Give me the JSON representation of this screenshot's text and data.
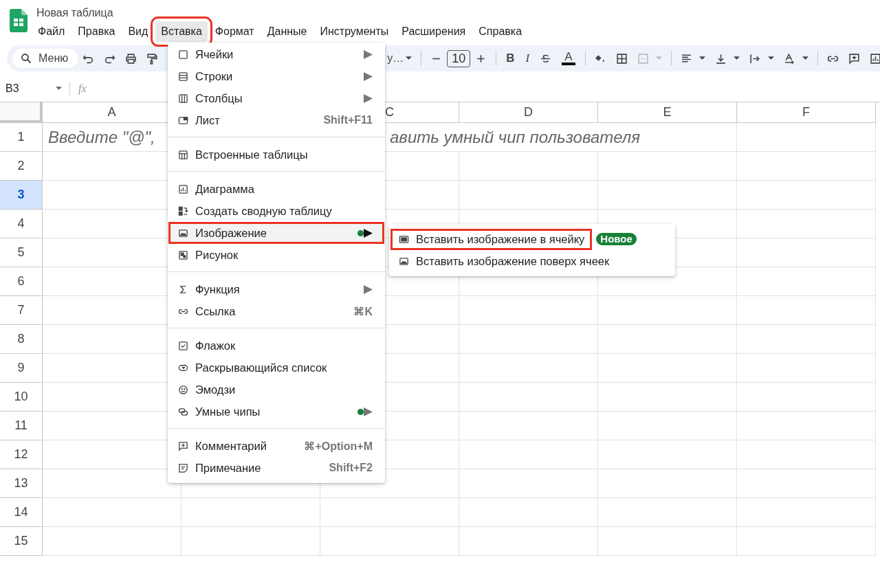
{
  "title": "Новая таблица",
  "menubar": [
    {
      "label": "Файл",
      "selected": false,
      "annotated": false
    },
    {
      "label": "Правка",
      "selected": false,
      "annotated": false
    },
    {
      "label": "Вид",
      "selected": false,
      "annotated": false
    },
    {
      "label": "Вставка",
      "selected": true,
      "annotated": true
    },
    {
      "label": "Формат",
      "selected": false,
      "annotated": false
    },
    {
      "label": "Данные",
      "selected": false,
      "annotated": false
    },
    {
      "label": "Инструменты",
      "selected": false,
      "annotated": false
    },
    {
      "label": "Расширения",
      "selected": false,
      "annotated": false
    },
    {
      "label": "Справка",
      "selected": false,
      "annotated": false
    }
  ],
  "toolbar": {
    "search": "Меню",
    "font": "у…",
    "font_size": "10",
    "bold": "B",
    "italic": "I",
    "text_color": "A"
  },
  "formula_bar": {
    "cell_ref": "B3",
    "fx": "fx"
  },
  "columns": [
    {
      "header": "A"
    },
    {},
    {
      "header": "C"
    },
    {
      "header": "D"
    },
    {
      "header": "E"
    },
    {
      "header": "F"
    }
  ],
  "rows": [
    {
      "number": "1",
      "selected": false
    },
    {
      "number": "2",
      "selected": false
    },
    {
      "number": "3",
      "selected": true
    },
    {
      "number": "4",
      "selected": false
    },
    {
      "number": "5",
      "selected": false
    },
    {
      "number": "6",
      "selected": false
    },
    {
      "number": "7",
      "selected": false
    },
    {
      "number": "8",
      "selected": false
    },
    {
      "number": "9",
      "selected": false
    },
    {
      "number": "10",
      "selected": false
    },
    {
      "number": "11",
      "selected": false
    },
    {
      "number": "12",
      "selected": false
    },
    {
      "number": "13",
      "selected": false
    },
    {
      "number": "14",
      "selected": false
    },
    {
      "number": "15",
      "selected": false
    }
  ],
  "row_1_hint": {
    "left_part": "Введите \"@\",",
    "right_part": "авить умный чип пользователя"
  },
  "insert_menu": {
    "sections": [
      [
        {
          "kind": "cells",
          "label": "Ячейки",
          "submenu": true,
          "new_dot": false,
          "selected": false,
          "annotated": false
        },
        {
          "kind": "rows",
          "label": "Строки",
          "submenu": true,
          "new_dot": false,
          "selected": false,
          "annotated": false
        },
        {
          "kind": "columns",
          "label": "Столбцы",
          "submenu": true,
          "new_dot": false,
          "selected": false,
          "annotated": false
        },
        {
          "kind": "sheet",
          "label": "Лист",
          "shortcut": "Shift+F11",
          "submenu": false,
          "new_dot": false,
          "selected": false,
          "annotated": false
        }
      ],
      [
        {
          "kind": "table",
          "label": "Встроенные таблицы",
          "submenu": false,
          "new_dot": false,
          "selected": false,
          "annotated": false
        }
      ],
      [
        {
          "kind": "chart",
          "label": "Диаграмма",
          "submenu": false,
          "new_dot": false,
          "selected": false,
          "annotated": false
        },
        {
          "kind": "pivot",
          "label": "Создать сводную таблицу",
          "submenu": false,
          "new_dot": false,
          "selected": false,
          "annotated": false
        },
        {
          "kind": "image",
          "label": "Изображение",
          "submenu": true,
          "new_dot": true,
          "selected": true,
          "annotated": true
        },
        {
          "kind": "drawing",
          "label": "Рисунок",
          "submenu": false,
          "new_dot": false,
          "selected": false,
          "annotated": false
        }
      ],
      [
        {
          "kind": "function",
          "label": "Функция",
          "submenu": true,
          "new_dot": false,
          "selected": false,
          "annotated": false
        },
        {
          "kind": "link",
          "label": "Ссылка",
          "shortcut": "⌘K",
          "submenu": false,
          "new_dot": false,
          "selected": false,
          "annotated": false
        }
      ],
      [
        {
          "kind": "checkbox",
          "label": "Флажок",
          "submenu": false,
          "new_dot": false,
          "selected": false,
          "annotated": false
        },
        {
          "kind": "dropdown",
          "label": "Раскрывающийся список",
          "submenu": false,
          "new_dot": false,
          "selected": false,
          "annotated": false
        },
        {
          "kind": "emoji",
          "label": "Эмодзи",
          "submenu": false,
          "new_dot": false,
          "selected": false,
          "annotated": false
        },
        {
          "kind": "chips",
          "label": "Умные чипы",
          "submenu": true,
          "new_dot": true,
          "selected": false,
          "annotated": false
        }
      ],
      [
        {
          "kind": "comment",
          "label": "Комментарий",
          "shortcut": "⌘+Option+M",
          "submenu": false,
          "new_dot": false,
          "selected": false,
          "annotated": false
        },
        {
          "kind": "note",
          "label": "Примечание",
          "shortcut": "Shift+F2",
          "submenu": false,
          "new_dot": false,
          "selected": false,
          "annotated": false
        }
      ]
    ]
  },
  "image_submenu": [
    {
      "kind": "image_in_cell",
      "label": "Вставить изображение в ячейку",
      "badge": "Новое",
      "annotated": true
    },
    {
      "kind": "image",
      "label": "Вставить изображение поверх ячеек",
      "annotated": false
    }
  ]
}
